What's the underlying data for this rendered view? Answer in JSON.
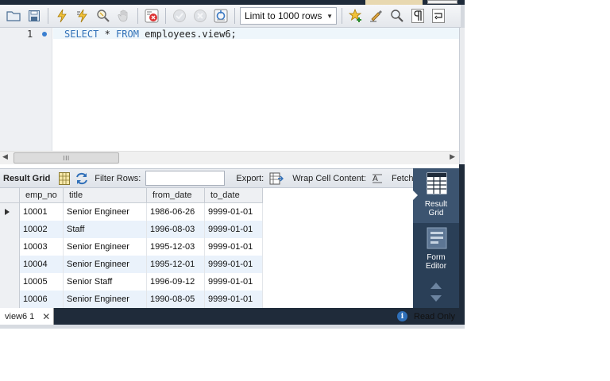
{
  "toolbar": {
    "buttons": [
      {
        "icon": "open-folder-icon"
      },
      {
        "icon": "save-icon"
      },
      {
        "icon": "execute-lightning-icon"
      },
      {
        "icon": "execute-current-icon"
      },
      {
        "icon": "explain-magnifier-icon"
      },
      {
        "icon": "stop-hand-icon"
      },
      {
        "icon": "toggle-error-icon"
      },
      {
        "icon": "commit-icon"
      },
      {
        "icon": "rollback-icon"
      },
      {
        "icon": "autocommit-icon"
      },
      {
        "icon": "bookmark-star-icon"
      },
      {
        "icon": "beautify-brush-icon"
      },
      {
        "icon": "find-magnifier-icon"
      },
      {
        "icon": "invisible-chars-icon"
      },
      {
        "icon": "wrap-lines-icon"
      }
    ],
    "limit_select": "Limit to 1000 rows"
  },
  "editor": {
    "line_number": "1",
    "code": {
      "kw1": "SELECT",
      "star": " * ",
      "kw2": "FROM",
      "rest": " employees.view6;"
    }
  },
  "hscroll": {
    "thumb_grip": "III"
  },
  "result_toolbar": {
    "result_grid": "Result Grid",
    "filter_rows": "Filter Rows:",
    "filter_value": "",
    "export": "Export:",
    "wrap_cell": "Wrap Cell Content:",
    "fetch": "Fetch"
  },
  "grid": {
    "columns": [
      "emp_no",
      "title",
      "from_date",
      "to_date"
    ],
    "rows": [
      [
        "10001",
        "Senior Engineer",
        "1986-06-26",
        "9999-01-01"
      ],
      [
        "10002",
        "Staff",
        "1996-08-03",
        "9999-01-01"
      ],
      [
        "10003",
        "Senior Engineer",
        "1995-12-03",
        "9999-01-01"
      ],
      [
        "10004",
        "Senior Engineer",
        "1995-12-01",
        "9999-01-01"
      ],
      [
        "10005",
        "Senior Staff",
        "1996-09-12",
        "9999-01-01"
      ],
      [
        "10006",
        "Senior Engineer",
        "1990-08-05",
        "9999-01-01"
      ]
    ],
    "selected_row": 0
  },
  "side_panel": {
    "result_grid_line1": "Result",
    "result_grid_line2": "Grid",
    "form_editor_line1": "Form",
    "form_editor_line2": "Editor"
  },
  "bottom_bar": {
    "tab_label": "view6 1",
    "status": "Read Only"
  },
  "colors": {
    "keyword": "#3272b8",
    "panel_bg": "#2a3f57",
    "panel_active": "#3c5470",
    "alt_row": "#eaf2fb"
  }
}
